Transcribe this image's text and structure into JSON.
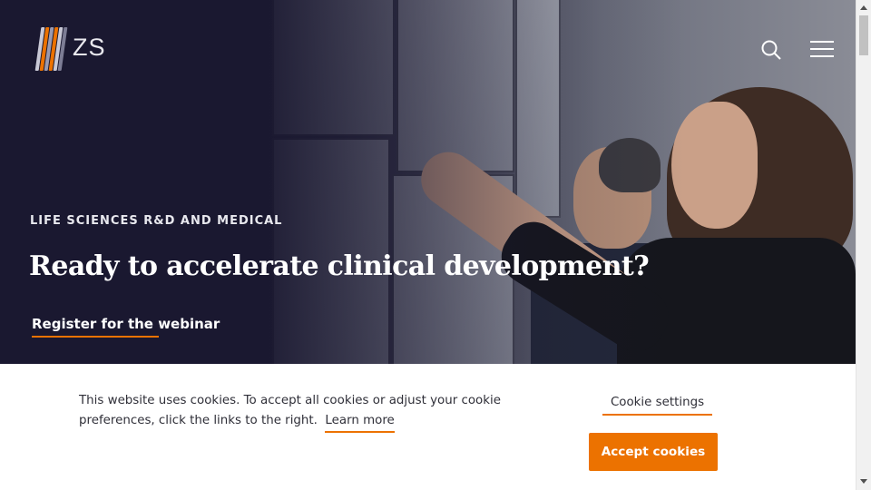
{
  "brand": {
    "name": "ZS",
    "bar_colors": [
      "#c9c9d6",
      "#ec7200",
      "#9a9ab0",
      "#ec7200",
      "#c9c9d6",
      "#7d7d95"
    ]
  },
  "nav": {
    "search_icon": "search-icon",
    "menu_icon": "hamburger-menu-icon"
  },
  "hero": {
    "eyebrow": "LIFE SCIENCES R&D AND MEDICAL",
    "headline": "Ready to accelerate clinical development?",
    "cta_link": "Register for the webinar"
  },
  "cookie_banner": {
    "message": "This website uses cookies. To accept all cookies or adjust your cookie preferences, click the links to the right.",
    "learn_more": "Learn more",
    "settings_label": "Cookie settings",
    "accept_label": "Accept cookies"
  },
  "colors": {
    "accent": "#ec7200",
    "hero_bg": "#1a1830",
    "text_dark": "#2f2f38"
  }
}
